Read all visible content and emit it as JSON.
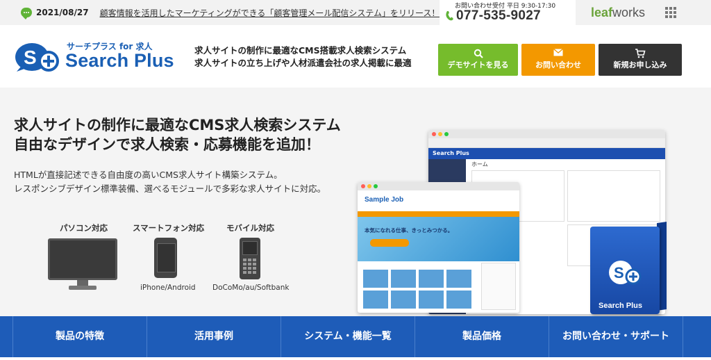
{
  "topbar": {
    "news_date": "2021/08/27",
    "news_text": "顧客情報を活用したマーケティングができる「顧客管理メール配信システム」をリリース！",
    "contact_label": "お問い合わせ受付 平日 9:30-17:30",
    "phone": "077-535-9027",
    "company_logo_a": "leaf",
    "company_logo_b": "works"
  },
  "header": {
    "logo_sub": "サーチプラス for 求人",
    "logo_main": "Search Plus",
    "tagline_1": "求人サイトの制作に最適なCMS搭載求人検索システム",
    "tagline_2": "求人サイトの立ち上げや人材派遣会社の求人掲載に最適",
    "buttons": {
      "demo": "デモサイトを見る",
      "contact": "お問い合わせ",
      "apply": "新規お申し込み"
    }
  },
  "hero": {
    "title_1": "求人サイトの制作に最適なCMS求人検索システム",
    "title_2": "自由なデザインで求人検索・応募機能を追加！",
    "desc_1": "HTMLが直接記述できる自由度の高いCMS求人サイト構築システム。",
    "desc_2": "レスポンシブデザイン標準装備、選べるモジュールで多彩な求人サイトに対応。",
    "devices": {
      "pc": "パソコン対応",
      "smartphone": "スマートフォン対応",
      "mobile": "モバイル対応",
      "smartphone_sub": "iPhone/Android",
      "mobile_sub": "DoCoMo/au/Softbank"
    },
    "mock": {
      "admin_brand": "Search Plus",
      "admin_home": "ホーム",
      "sample_brand": "Sample Job",
      "banner_text": "本気になれる仕事、きっとみつかる。",
      "box_name": "Search Plus"
    }
  },
  "nav": {
    "items": [
      "製品の特徴",
      "活用事例",
      "システム・機能一覧",
      "製品価格",
      "お問い合わせ・サポート"
    ]
  },
  "colors": {
    "brand_blue": "#1e5cb8",
    "demo_green": "#76bc2c",
    "contact_orange": "#f39800",
    "apply_dark": "#333333"
  }
}
